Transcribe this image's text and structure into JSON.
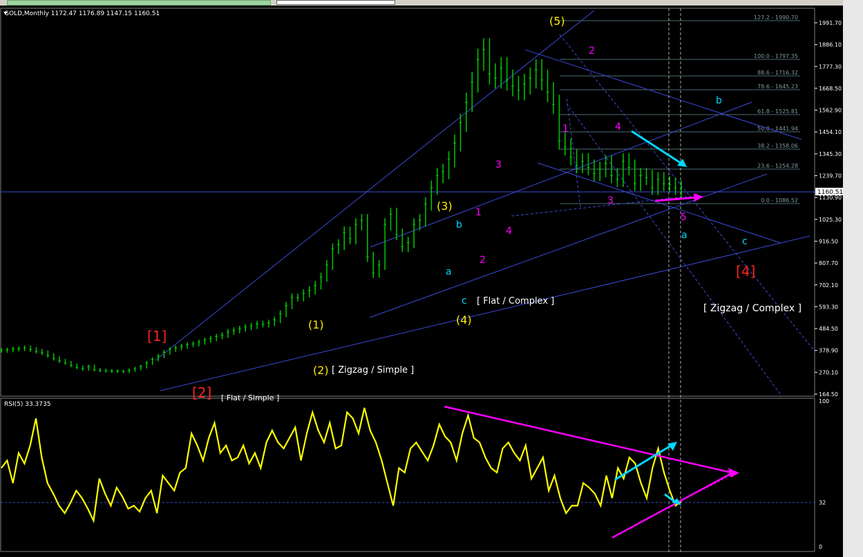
{
  "colors": {
    "background": "#000000",
    "candles": "#00c800",
    "trendline": "#3b4bd8",
    "fib": "#4b6b74",
    "rsi": "#ffff00",
    "magenta": "#ff00ff",
    "cyan": "#00d8ff",
    "yellow_label": "#ffea00",
    "red_label": "#ff2020"
  },
  "price_panel": {
    "header": "GOLD,Monthly  1172.47  1176.89  1147.15  1160.51",
    "current_price": "1160.51",
    "axis_ticks": [
      "1991.70",
      "1886.10",
      "1777.30",
      "1668.50",
      "1562.90",
      "1454.10",
      "1345.30",
      "1239.70",
      "1130.90",
      "1025.30",
      "916.50",
      "807.70",
      "702.10",
      "593.30",
      "484.50",
      "378.90",
      "270.10",
      "164.50"
    ],
    "fib_levels": [
      "127.2 - 1990.70",
      "100.0 - 1797.35",
      "88.6 - 1716.32",
      "78.6 - 1645.23",
      "61.8 - 1525.81",
      "50.0 - 1441.94",
      "38.2 - 1358.06",
      "23.6 - 1254.28",
      "0.0 - 1086.52"
    ],
    "labels": {
      "w1_big": "[1]",
      "w2_big": "[2]",
      "w2_big_note": "[ Flat / Simple ]",
      "w4_big": "[4]",
      "w1": "(1)",
      "w2": "(2)",
      "w2_note": "[ Zigzag / Simple ]",
      "w3": "(3)",
      "w4": "(4)",
      "w4_note": "[ Flat / Complex ]",
      "w5": "(5)",
      "big4_note": "[ Zigzag / Complex ]",
      "m1": "1",
      "m2": "2",
      "m3": "3",
      "m4": "4",
      "d1": "1",
      "d2": "2",
      "d3": "3",
      "d4": "4",
      "d5": "5",
      "a_left": "a",
      "b_left": "b",
      "c_left": "c",
      "a_right": "a",
      "b_right": "b",
      "c_right": "c"
    }
  },
  "rsi_panel": {
    "header": "RSI(5) 33.3735",
    "axis_ticks": [
      "100",
      "32",
      "0"
    ]
  },
  "chart_data": {
    "type": "line",
    "title": "GOLD,Monthly",
    "ohlc_last": {
      "open": 1172.47,
      "high": 1176.89,
      "low": 1147.15,
      "close": 1160.51
    },
    "series": [
      {
        "name": "GOLD",
        "values": [
          380,
          382,
          386,
          388,
          392,
          384,
          375,
          368,
          355,
          340,
          328,
          318,
          306,
          296,
          289,
          300,
          285,
          281,
          279,
          278,
          277,
          276,
          282,
          290,
          300,
          318,
          336,
          352,
          370,
          384,
          392,
          400,
          408,
          412,
          420,
          430,
          438,
          448,
          455,
          470,
          478,
          486,
          494,
          500,
          510,
          508,
          515,
          530,
          560,
          600,
          640,
          640,
          660,
          675,
          700,
          740,
          800,
          880,
          900,
          960,
          930,
          1000,
          1020,
          840,
          760,
          800,
          1000,
          1050,
          950,
          890,
          910,
          1000,
          1020,
          1100,
          1180,
          1240,
          1260,
          1320,
          1400,
          1500,
          1600,
          1700,
          1810,
          1860,
          1740,
          1720,
          1770,
          1710,
          1680,
          1660,
          1690,
          1720,
          1760,
          1710,
          1650,
          1590,
          1410,
          1380,
          1330,
          1290,
          1310,
          1280,
          1250,
          1270,
          1300,
          1240,
          1220,
          1310,
          1280,
          1200,
          1240,
          1230,
          1180,
          1220,
          1200,
          1195,
          1180,
          1160
        ]
      },
      {
        "name": "RSI(5)",
        "values": [
          55,
          60,
          45,
          65,
          58,
          70,
          88,
          62,
          45,
          38,
          30,
          25,
          32,
          40,
          35,
          28,
          20,
          48,
          38,
          30,
          42,
          36,
          28,
          30,
          26,
          35,
          40,
          25,
          50,
          45,
          40,
          52,
          55,
          78,
          70,
          60,
          75,
          85,
          65,
          70,
          60,
          62,
          70,
          58,
          65,
          55,
          72,
          80,
          72,
          68,
          75,
          82,
          60,
          78,
          92,
          80,
          72,
          85,
          68,
          70,
          92,
          88,
          78,
          95,
          80,
          72,
          60,
          45,
          30,
          55,
          52,
          68,
          72,
          66,
          60,
          70,
          84,
          76,
          72,
          60,
          78,
          90,
          75,
          72,
          62,
          55,
          52,
          68,
          72,
          65,
          60,
          70,
          48,
          55,
          62,
          40,
          50,
          35,
          25,
          30,
          30,
          45,
          42,
          38,
          30,
          50,
          35,
          55,
          48,
          62,
          58,
          45,
          35,
          55,
          68,
          52,
          40,
          30,
          33
        ]
      }
    ],
    "ylim": [
      164.5,
      1991.7
    ],
    "rsi_ylim": [
      0,
      100
    ]
  }
}
